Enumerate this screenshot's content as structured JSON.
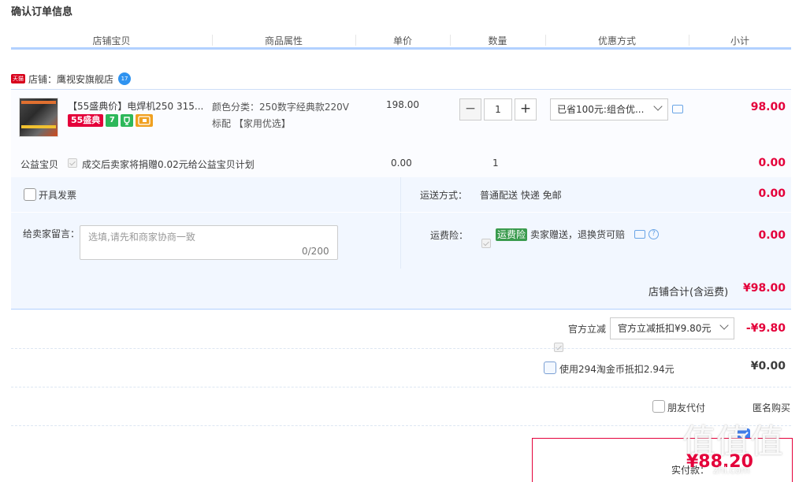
{
  "page": {
    "title": "确认订单信息"
  },
  "columns": [
    "店铺宝贝",
    "商品属性",
    "单价",
    "数量",
    "优惠方式",
    "小计"
  ],
  "shop": {
    "badge": "天猫",
    "label": "店铺：",
    "name": "鹰视安旗舰店",
    "wangwang_badge": "17"
  },
  "item": {
    "name": "【55盛典价】电焊机250 315...",
    "badge_55": "55盛典",
    "badge_seven": "7",
    "attr_line1": "颜色分类：250数字经典款220V",
    "attr_line2": "标配 【家用优选】",
    "price": "198.00",
    "quantity": "1",
    "discount_selected": "已省100元:组合优...",
    "subtotal": "98.00"
  },
  "charity": {
    "label": "公益宝贝",
    "text": "成交后卖家将捐赠0.02元给公益宝贝计划",
    "price": "0.00",
    "quantity": "1",
    "subtotal": "0.00"
  },
  "invoice": {
    "label": "开具发票"
  },
  "shipping": {
    "label": "运送方式：",
    "value": "普通配送 快递 免邮",
    "amount": "0.00"
  },
  "message": {
    "label": "给卖家留言：",
    "placeholder": "选填,请先和商家协商一致",
    "counter": "0/200"
  },
  "insurance": {
    "label": "运费险：",
    "tag": "运费险",
    "text": "卖家赠送，退换货可赔",
    "amount": "0.00"
  },
  "shop_total": {
    "label": "店铺合计(含运费)",
    "amount": "¥98.00"
  },
  "official_discount": {
    "label": "官方立减",
    "selected": "官方立减抵扣¥9.80元",
    "amount": "-¥9.80"
  },
  "coins": {
    "label": "使用294淘金币抵扣2.94元",
    "amount": "¥0.00"
  },
  "friend_pay": {
    "label": "朋友代付"
  },
  "anonymous": {
    "label": "匿名购买"
  },
  "payment": {
    "label": "实付款：",
    "amount": "¥88.20"
  },
  "watermark": {
    "text": "值值值",
    "url": "zhi.com"
  },
  "colors": {
    "accent_red": "#e4003a",
    "header_blue": "#b2d1ff",
    "panel_blue": "#f2f7ff",
    "checkbox_blue": "#3e7ef0"
  }
}
